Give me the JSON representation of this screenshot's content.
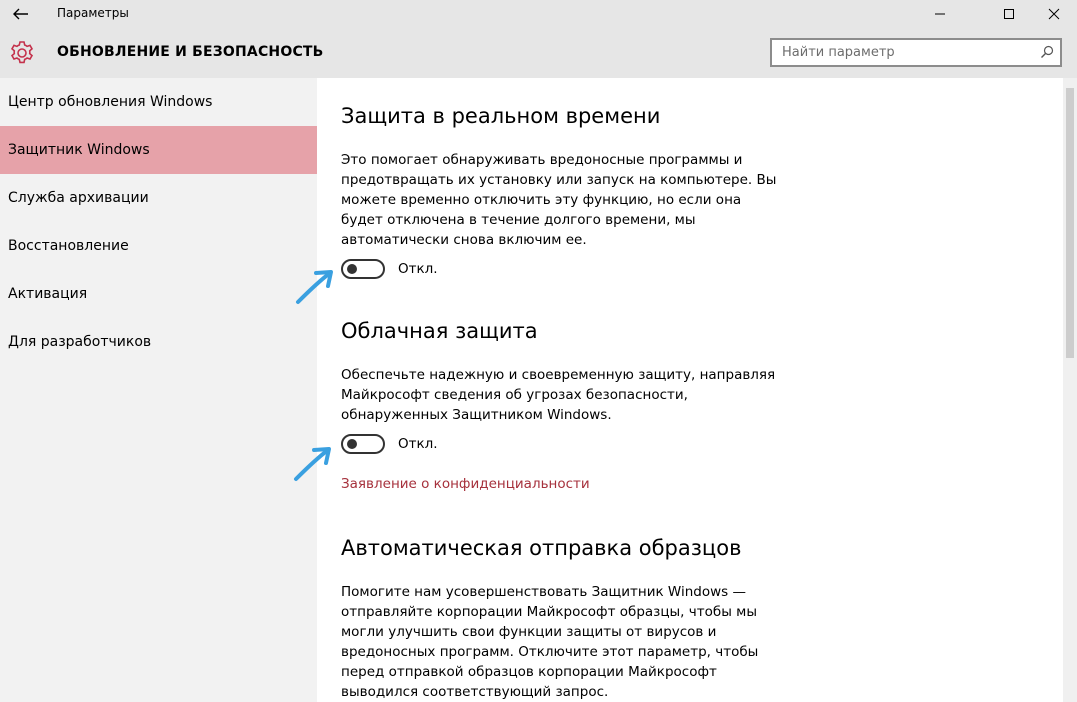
{
  "window": {
    "title": "Параметры",
    "back_icon": "back-arrow-icon",
    "minimize_icon": "minimize-icon",
    "maximize_icon": "maximize-icon",
    "close_icon": "close-icon"
  },
  "header": {
    "icon": "gear-icon",
    "title": "ОБНОВЛЕНИЕ И БЕЗОПАСНОСТЬ",
    "accent_color": "#c4314b",
    "search": {
      "placeholder": "Найти параметр",
      "value": "",
      "icon": "search-icon"
    }
  },
  "sidebar": {
    "selected_color": "#e6a2a9",
    "items": [
      {
        "label": "Центр обновления Windows",
        "selected": false
      },
      {
        "label": "Защитник Windows",
        "selected": true
      },
      {
        "label": "Служба архивации",
        "selected": false
      },
      {
        "label": "Восстановление",
        "selected": false
      },
      {
        "label": "Активация",
        "selected": false
      },
      {
        "label": "Для разработчиков",
        "selected": false
      }
    ]
  },
  "content": {
    "realtime": {
      "title": "Защита в реальном времени",
      "description": "Это помогает обнаруживать вредоносные программы и предотвращать их установку или запуск на компьютере. Вы можете временно отключить эту функцию, но если она будет отключена в течение долгого времени, мы автоматически снова включим ее.",
      "toggle_state": "Откл."
    },
    "cloud": {
      "title": "Облачная защита",
      "description": "Обеспечьте надежную и своевременную защиту, направляя Майкрософт сведения об угрозах безопасности, обнаруженных Защитником Windows.",
      "toggle_state": "Откл.",
      "privacy_link": "Заявление о конфиденциальности"
    },
    "samples": {
      "title": "Автоматическая отправка образцов",
      "description": "Помогите нам усовершенствовать Защитник Windows — отправляйте корпорации Майкрософт образцы, чтобы мы могли улучшить свои функции защиты от вирусов и вредоносных программ. Отключите этот параметр, чтобы перед отправкой образцов корпорации Майкрософт выводился соответствующий запрос."
    },
    "annotation_color": "#3aa0e0"
  }
}
